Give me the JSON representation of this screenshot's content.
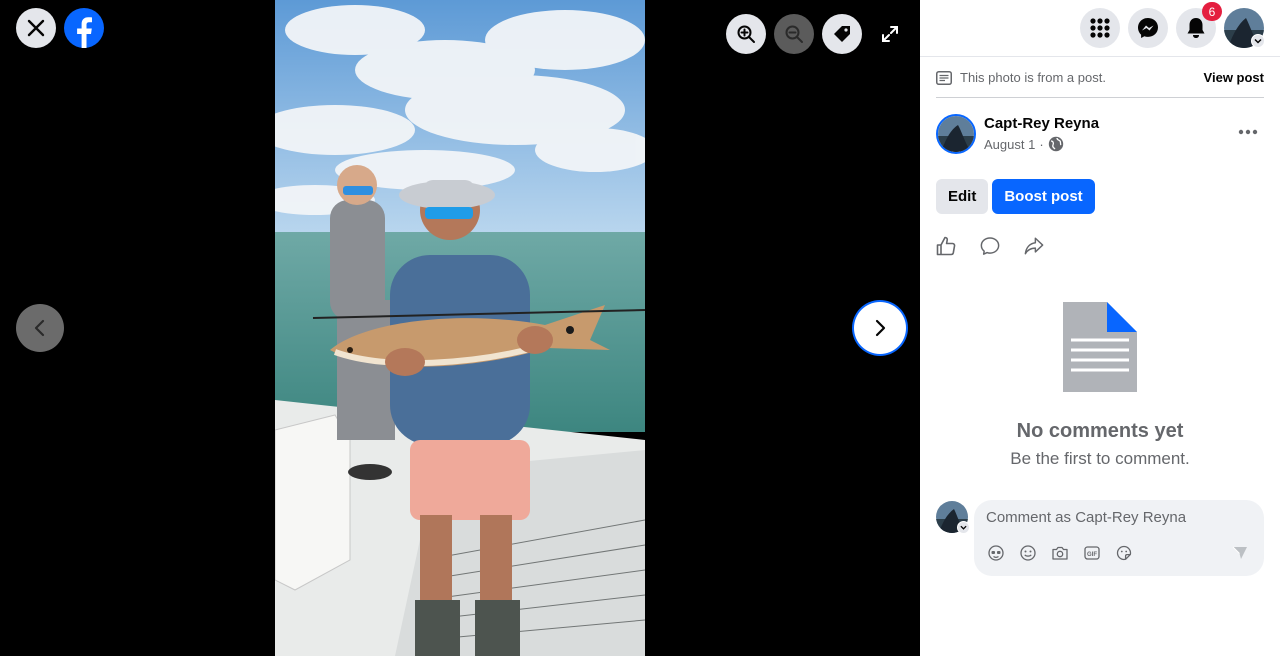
{
  "viewer": {
    "icons": {
      "close": "close-icon",
      "logo": "facebook-logo-icon",
      "zoom_in": "zoom-in-icon",
      "zoom_out": "zoom-out-icon",
      "tag": "tag-icon",
      "fullscreen": "fullscreen-icon",
      "prev": "chevron-left-icon",
      "next": "chevron-right-icon"
    }
  },
  "topbar": {
    "notification_count": "6",
    "icons": [
      "menu-grid-icon",
      "messenger-icon",
      "bell-icon",
      "account-avatar"
    ]
  },
  "post": {
    "from_post_text": "This photo is from a post.",
    "view_post_label": "View post",
    "author_name": "Capt-Rey Reyna",
    "date": "August 1",
    "separator": "·",
    "privacy_icon": "globe-icon",
    "edit_label": "Edit",
    "boost_label": "Boost post",
    "actions": [
      "like-icon",
      "comment-icon",
      "share-icon"
    ]
  },
  "comments": {
    "empty_title": "No comments yet",
    "empty_subtitle": "Be the first to comment.",
    "composer_placeholder": "Comment as Capt-Rey Reyna",
    "composer_tools": [
      "avatar-sticker-icon",
      "emoji-icon",
      "camera-icon",
      "gif-icon",
      "sticker-icon"
    ],
    "send_icon": "send-icon"
  },
  "colors": {
    "brand_blue": "#0866ff",
    "badge_red": "#e41e3f",
    "secondary_text": "#65676b",
    "gray_button": "#e4e6eb"
  }
}
